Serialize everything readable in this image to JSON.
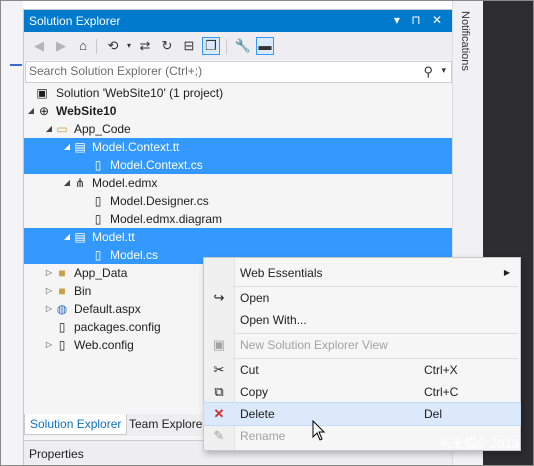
{
  "panel": {
    "title": "Solution Explorer",
    "title_buttons": [
      "▾",
      "⊓",
      "✕"
    ]
  },
  "search": {
    "placeholder": "Search Solution Explorer (Ctrl+;)"
  },
  "tree": [
    {
      "label": "Solution 'WebSite10' (1 project)",
      "icon": "solution-icon"
    },
    {
      "label": "WebSite10",
      "icon": "globe-icon",
      "bold": true,
      "expanded": true
    },
    {
      "label": "App_Code",
      "icon": "folder-open-icon",
      "expanded": true
    },
    {
      "label": "Model.Context.tt",
      "icon": "tt-file-icon",
      "expanded": true,
      "selected": true
    },
    {
      "label": "Model.Context.cs",
      "icon": "cs-file-icon",
      "selected": true
    },
    {
      "label": "Model.edmx",
      "icon": "edmx-icon",
      "expanded": true
    },
    {
      "label": "Model.Designer.cs",
      "icon": "cs-file-icon"
    },
    {
      "label": "Model.edmx.diagram",
      "icon": "cs-file-icon"
    },
    {
      "label": "Model.tt",
      "icon": "tt-file-icon",
      "expanded": true,
      "selected": true
    },
    {
      "label": "Model.cs",
      "icon": "cs-file-icon",
      "selected": true
    },
    {
      "label": "App_Data",
      "icon": "folder-icon",
      "collapsed": true
    },
    {
      "label": "Bin",
      "icon": "folder-icon",
      "collapsed": true
    },
    {
      "label": "Default.aspx",
      "icon": "aspx-icon",
      "collapsed": true
    },
    {
      "label": "packages.config",
      "icon": "config-icon"
    },
    {
      "label": "Web.config",
      "icon": "config-icon",
      "collapsed": true
    }
  ],
  "tabs": [
    "Solution Explorer",
    "Team Explorer"
  ],
  "properties_label": "Properties",
  "notifications_label": "Notifications",
  "context_menu": {
    "items": [
      {
        "label": "Web Essentials",
        "submenu": true
      },
      {
        "label": "Open",
        "icon": "open-icon"
      },
      {
        "label": "Open With..."
      },
      {
        "label": "New Solution Explorer View",
        "icon": "new-view-icon",
        "disabled": true
      },
      {
        "label": "Cut",
        "icon": "cut-icon",
        "shortcut": "Ctrl+X"
      },
      {
        "label": "Copy",
        "icon": "copy-icon",
        "shortcut": "Ctrl+C"
      },
      {
        "label": "Delete",
        "icon": "delete-icon",
        "shortcut": "Del",
        "highlighted": true
      },
      {
        "label": "Rename",
        "icon": "rename-icon",
        "disabled": true
      }
    ]
  },
  "watermark": "米米貓© 2013",
  "colors": {
    "accent": "#007acc",
    "selection": "#3399ff",
    "delete_red": "#d32f2f"
  }
}
